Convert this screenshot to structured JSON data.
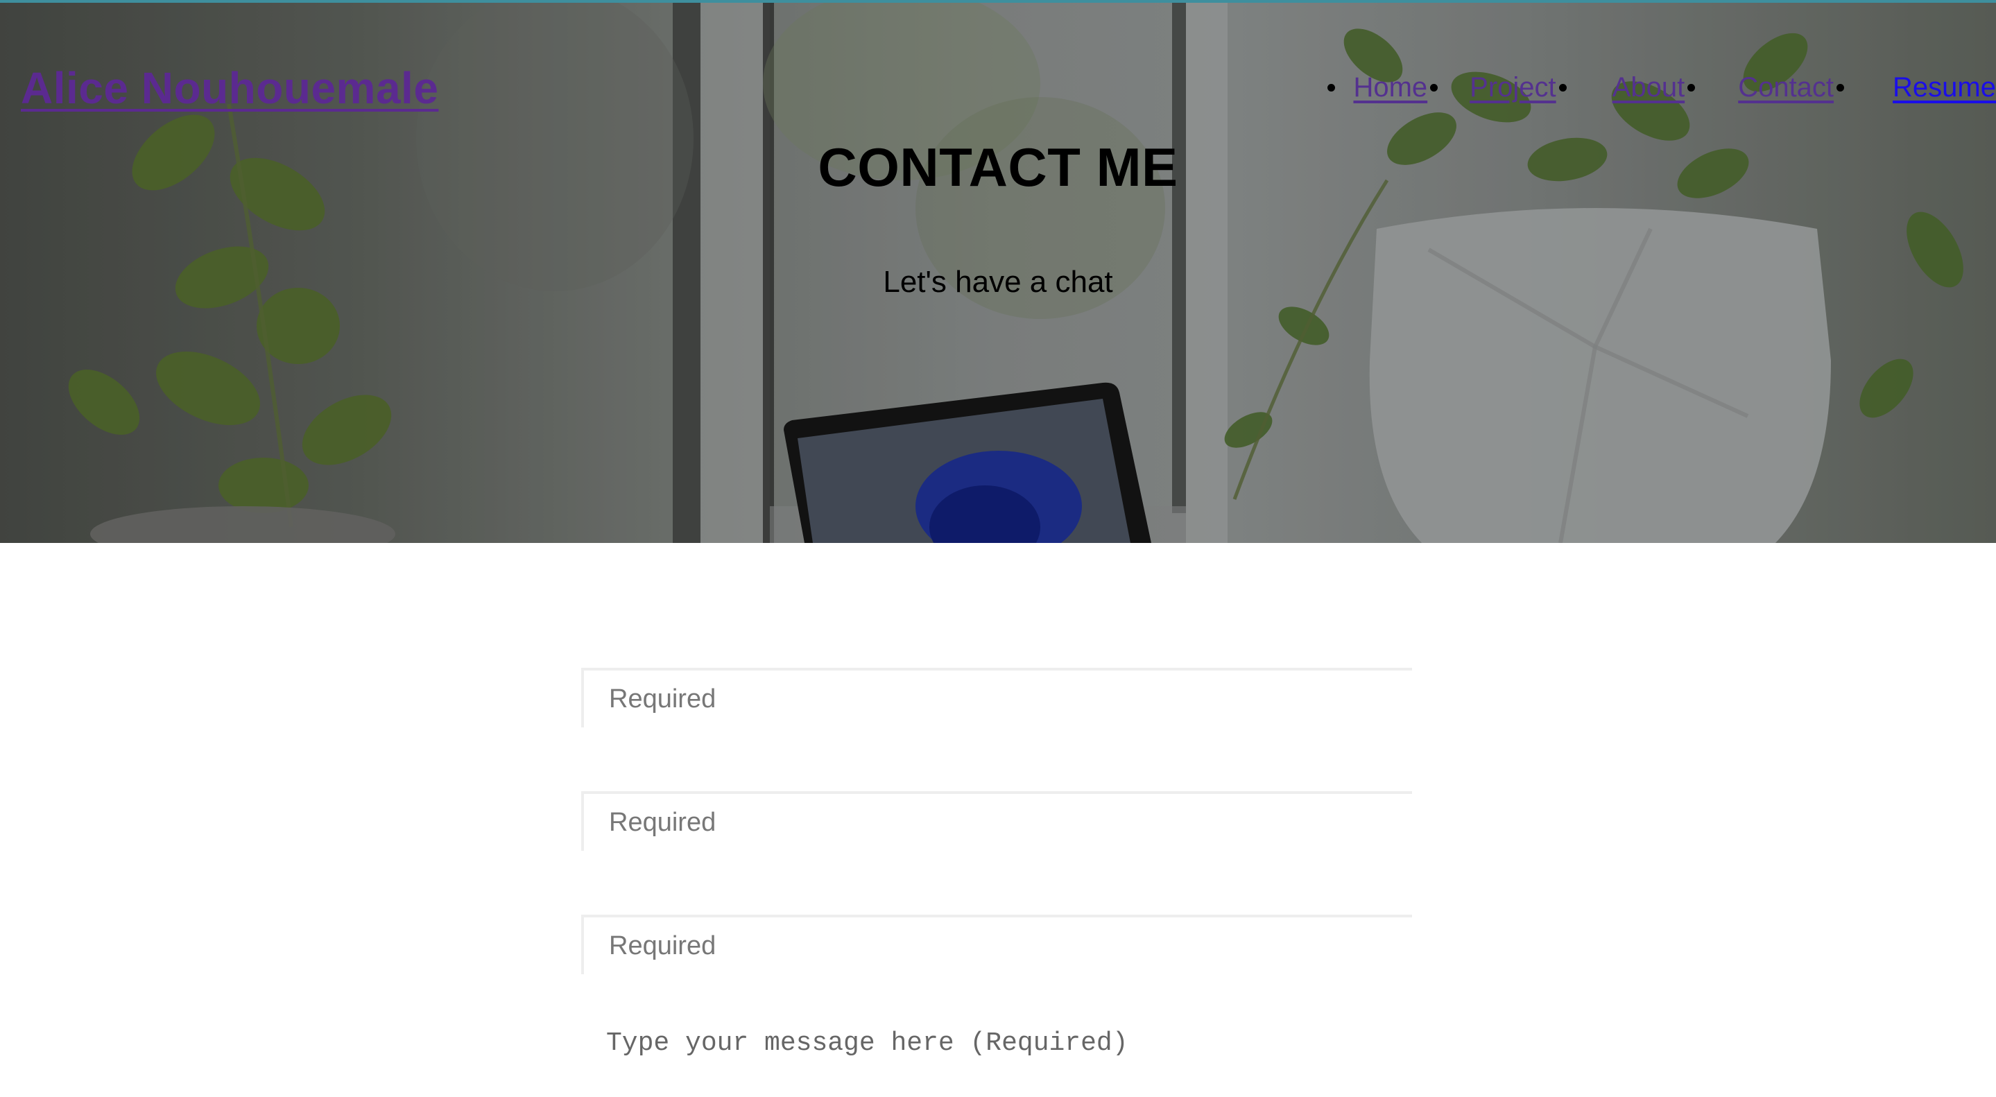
{
  "header": {
    "site_title": "Alice Nouhouemale",
    "nav": {
      "home": "Home",
      "project": "Project",
      "about": "About",
      "contact": "Contact",
      "resume": "Resume"
    }
  },
  "hero": {
    "heading": "CONTACT ME",
    "subheading": "Let's have a chat"
  },
  "form": {
    "field_1_placeholder": "Required",
    "field_2_placeholder": "Required",
    "field_3_placeholder": "Required",
    "message_placeholder": "Type your message here (Required)"
  },
  "colors": {
    "visited_link": "#54318f",
    "unvisited_link": "#1a0ee8",
    "hero_top_line": "#3e8f9e",
    "input_border": "#eeeeee"
  }
}
